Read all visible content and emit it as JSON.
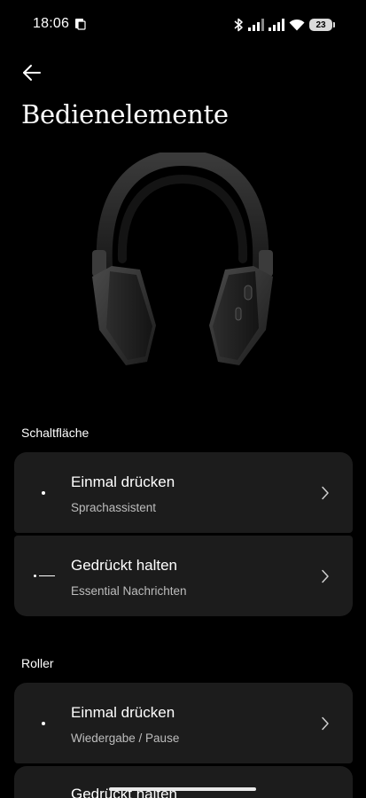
{
  "status_bar": {
    "time": "18:06",
    "battery": "23",
    "icons": [
      "app-notification-icon",
      "bluetooth-icon",
      "signal-icon",
      "signal-icon",
      "wifi-icon",
      "battery-icon"
    ]
  },
  "header": {
    "back_icon": "arrow-left-icon",
    "title": "Bedienelemente"
  },
  "sections": [
    {
      "heading": "Schaltfläche",
      "items": [
        {
          "icon": "single-dot-icon",
          "title": "Einmal drücken",
          "subtitle": "Sprachassistent"
        },
        {
          "icon": "dot-dash-icon",
          "title": "Gedrückt halten",
          "subtitle": "Essential Nachrichten"
        }
      ]
    },
    {
      "heading": "Roller",
      "items": [
        {
          "icon": "single-dot-icon",
          "title": "Einmal drücken",
          "subtitle": "Wiedergabe / Pause"
        },
        {
          "icon": "dot-dash-icon",
          "title": "Gedrückt halten",
          "subtitle": ""
        }
      ]
    }
  ],
  "colors": {
    "background": "#000000",
    "card": "#1c1c1c",
    "text": "#ffffff",
    "secondary_text": "#bdbdbd"
  }
}
